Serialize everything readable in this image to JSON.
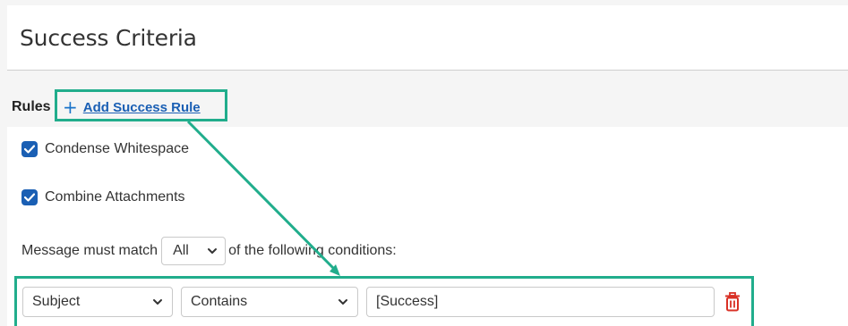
{
  "header": {
    "title": "Success Criteria"
  },
  "rules": {
    "label": "Rules",
    "add_link": "Add Success Rule"
  },
  "options": {
    "condense": {
      "label": "Condense Whitespace",
      "checked": true
    },
    "combine": {
      "label": "Combine Attachments",
      "checked": true
    }
  },
  "match": {
    "prefix": "Message must match",
    "selected": "All",
    "suffix": "of the following conditions:"
  },
  "condition": {
    "field": "Subject",
    "operator": "Contains",
    "value": "[Success]"
  },
  "colors": {
    "highlight": "#21ad8c",
    "link": "#1a5fb4",
    "checkbox": "#1a5fb4",
    "delete": "#d93025"
  },
  "icons": {
    "add": "plus-icon",
    "checkbox": "checkmark-icon",
    "dropdown": "chevron-down-icon",
    "delete": "trash-icon"
  }
}
